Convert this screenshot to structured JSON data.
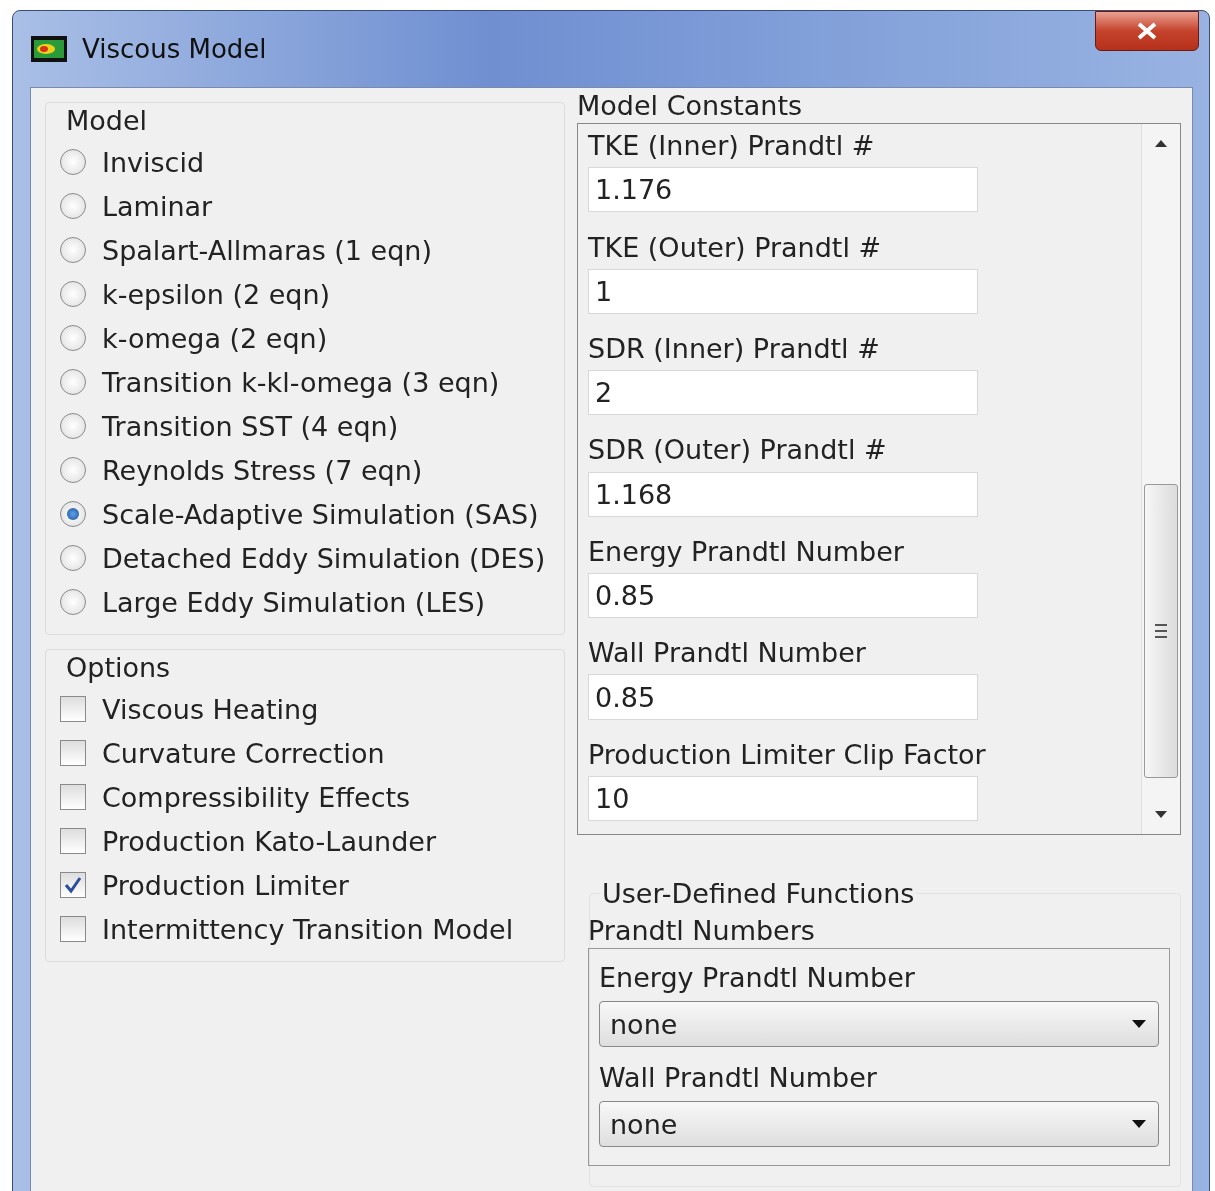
{
  "window": {
    "title": "Viscous Model"
  },
  "model": {
    "title": "Model",
    "options": [
      {
        "label": "Inviscid",
        "selected": false
      },
      {
        "label": "Laminar",
        "selected": false
      },
      {
        "label": "Spalart-Allmaras (1 eqn)",
        "selected": false
      },
      {
        "label": "k-epsilon (2 eqn)",
        "selected": false
      },
      {
        "label": "k-omega (2 eqn)",
        "selected": false
      },
      {
        "label": "Transition k-kl-omega (3 eqn)",
        "selected": false
      },
      {
        "label": "Transition SST (4 eqn)",
        "selected": false
      },
      {
        "label": "Reynolds Stress (7 eqn)",
        "selected": false
      },
      {
        "label": "Scale-Adaptive Simulation (SAS)",
        "selected": true
      },
      {
        "label": "Detached Eddy Simulation (DES)",
        "selected": false
      },
      {
        "label": "Large Eddy Simulation (LES)",
        "selected": false
      }
    ]
  },
  "options": {
    "title": "Options",
    "items": [
      {
        "label": "Viscous Heating",
        "checked": false
      },
      {
        "label": "Curvature Correction",
        "checked": false
      },
      {
        "label": "Compressibility Effects",
        "checked": false
      },
      {
        "label": "Production Kato-Launder",
        "checked": false
      },
      {
        "label": "Production Limiter",
        "checked": true
      },
      {
        "label": "Intermittency Transition Model",
        "checked": false
      }
    ]
  },
  "model_constants": {
    "title": "Model Constants",
    "items": [
      {
        "label": "TKE (Inner) Prandtl #",
        "value": "1.176"
      },
      {
        "label": "TKE (Outer) Prandtl #",
        "value": "1"
      },
      {
        "label": "SDR (Inner) Prandtl #",
        "value": "2"
      },
      {
        "label": "SDR (Outer) Prandtl #",
        "value": "1.168"
      },
      {
        "label": "Energy Prandtl Number",
        "value": "0.85"
      },
      {
        "label": "Wall Prandtl Number",
        "value": "0.85"
      },
      {
        "label": "Production Limiter Clip Factor",
        "value": "10"
      }
    ]
  },
  "user_defined_functions": {
    "title": "User-Defined Functions",
    "prandtl_numbers": {
      "title": "Prandtl Numbers",
      "items": [
        {
          "label": "Energy Prandtl Number",
          "value": "none"
        },
        {
          "label": "Wall Prandtl Number",
          "value": "none"
        }
      ]
    }
  }
}
